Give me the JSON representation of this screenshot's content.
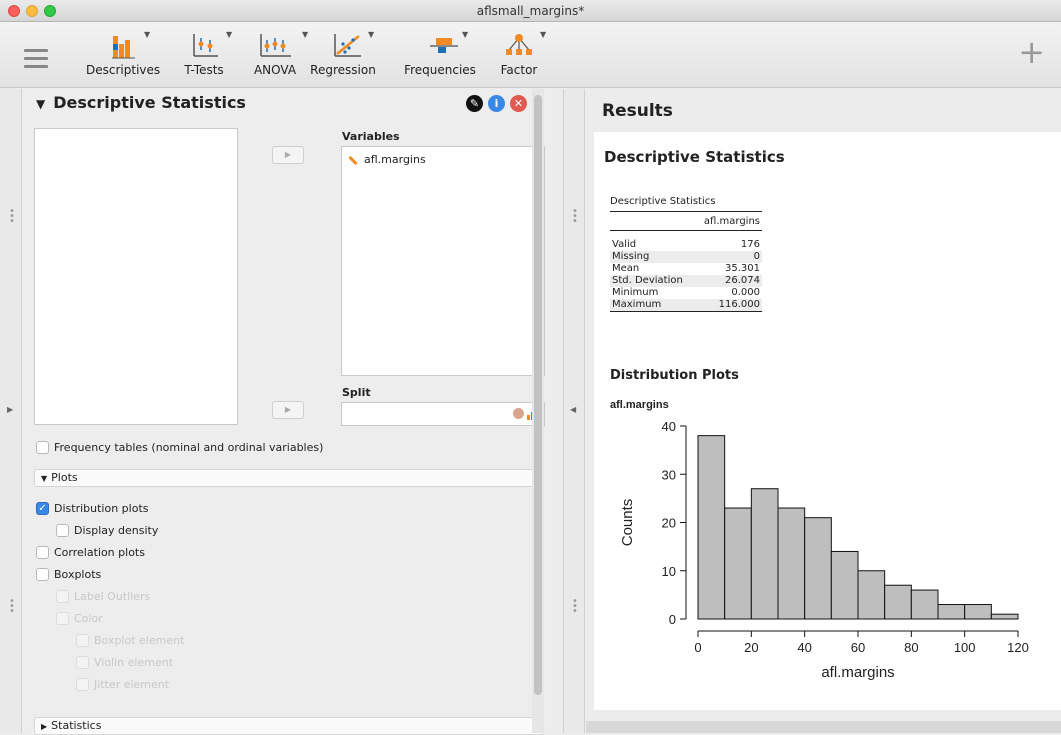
{
  "window": {
    "title": "aflsmall_margins*"
  },
  "ribbon": {
    "buttons": [
      {
        "label": "Descriptives"
      },
      {
        "label": "T-Tests"
      },
      {
        "label": "ANOVA"
      },
      {
        "label": "Regression"
      },
      {
        "label": "Frequencies"
      },
      {
        "label": "Factor"
      }
    ]
  },
  "analysis": {
    "title": "Descriptive Statistics",
    "variables_label": "Variables",
    "split_label": "Split",
    "variable_item": "afl.margins",
    "freq_tables_label": "Frequency tables (nominal and ordinal variables)",
    "plots_section": "Plots",
    "distribution_plots": "Distribution plots",
    "display_density": "Display density",
    "correlation_plots": "Correlation plots",
    "boxplots": "Boxplots",
    "label_outliers": "Label Outliers",
    "color": "Color",
    "boxplot_element": "Boxplot element",
    "violin_element": "Violin element",
    "jitter_element": "Jitter element",
    "statistics_section": "Statistics"
  },
  "results": {
    "title": "Results",
    "heading": "Descriptive Statistics",
    "table": {
      "caption": "Descriptive Statistics",
      "column": "afl.margins",
      "rows": [
        {
          "label": "Valid",
          "value": "176"
        },
        {
          "label": "Missing",
          "value": "0"
        },
        {
          "label": "Mean",
          "value": "35.301"
        },
        {
          "label": "Std. Deviation",
          "value": "26.074"
        },
        {
          "label": "Minimum",
          "value": "0.000"
        },
        {
          "label": "Maximum",
          "value": "116.000"
        }
      ]
    },
    "plots_heading": "Distribution Plots",
    "plot_var": "afl.margins"
  },
  "chart_data": {
    "type": "bar",
    "title": "afl.margins",
    "xlabel": "afl.margins",
    "ylabel": "Counts",
    "bins": [
      0,
      10,
      20,
      30,
      40,
      50,
      60,
      70,
      80,
      90,
      100,
      110,
      120
    ],
    "values": [
      38,
      23,
      27,
      23,
      21,
      14,
      10,
      7,
      6,
      3,
      3,
      1
    ],
    "xticks": [
      "0",
      "20",
      "40",
      "60",
      "80",
      "100",
      "120"
    ],
    "yticks": [
      "0",
      "10",
      "20",
      "30",
      "40"
    ],
    "xlim": [
      0,
      120
    ],
    "ylim": [
      0,
      40
    ],
    "bar_color": "#bebebe"
  }
}
